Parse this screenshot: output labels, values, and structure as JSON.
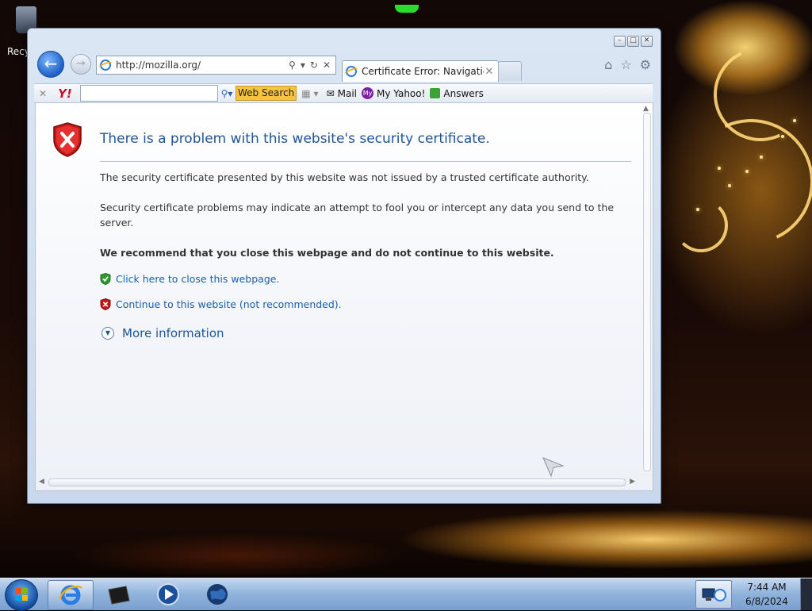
{
  "desktop": {
    "recycle_bin_label": "Recy"
  },
  "browser": {
    "window_buttons": {
      "minimize": "–",
      "maximize": "□",
      "close": "✕"
    },
    "address": {
      "url": "http://mozilla.org/"
    },
    "tab": {
      "title": "Certificate Error: Navigatio...",
      "close": "✕"
    },
    "command_icons": [
      "home-icon",
      "favorites-star-icon",
      "tools-gear-icon"
    ]
  },
  "yahoo_toolbar": {
    "close": "✕",
    "logo": "Y!",
    "search_value": "",
    "web_search_label": "Web Search",
    "mail_label": "Mail",
    "my_yahoo_label": "My Yahoo!",
    "answers_label": "Answers"
  },
  "page": {
    "title": "There is a problem with this website's security certificate.",
    "paragraph1": "The security certificate presented by this website was not issued by a trusted certificate authority.",
    "paragraph2": "Security certificate problems may indicate an attempt to fool you or intercept any data you send to the server.",
    "recommendation": "We recommend that you close this webpage and do not continue to this website.",
    "close_link": "Click here to close this webpage.",
    "continue_link": "Continue to this website (not recommended).",
    "more_info": "More information"
  },
  "taskbar": {
    "items": [
      "internet-explorer",
      "file-manager",
      "media-player",
      "globe-app"
    ],
    "clock": {
      "time": "7:44 AM",
      "date": "6/8/2024"
    }
  },
  "colors": {
    "link_blue": "#1a5fa8",
    "title_blue": "#1f5596",
    "yahoo_red": "#c8102e",
    "web_search_yellow": "#f5c242"
  }
}
